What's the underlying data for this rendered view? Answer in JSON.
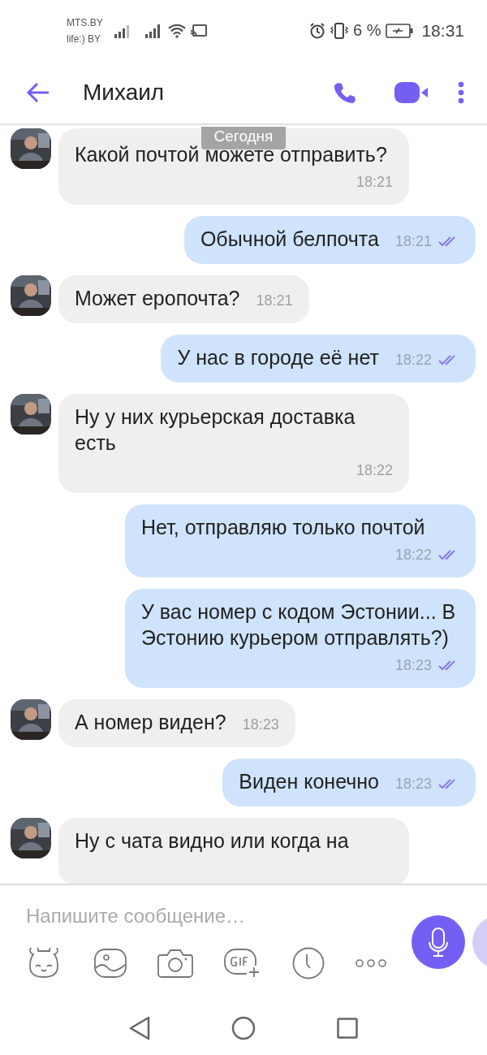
{
  "status_bar": {
    "carriers": [
      "MTS.BY",
      "life:) BY"
    ],
    "battery": "6 %",
    "time": "18:31"
  },
  "header": {
    "title": "Михаил"
  },
  "date_badge": "Сегодня",
  "messages": [
    {
      "kind": "received",
      "text": "Какой почтой можете отправить?",
      "time": "18:21"
    },
    {
      "kind": "sent",
      "text": "Обычной белпочта",
      "time": "18:21"
    },
    {
      "kind": "received",
      "text": "Может еропочта?",
      "time": "18:21"
    },
    {
      "kind": "sent",
      "text": "У нас в городе её нет",
      "time": "18:22"
    },
    {
      "kind": "received",
      "text": "Ну у них курьерская доставка есть",
      "time": "18:22"
    },
    {
      "kind": "sent",
      "text": "Нет, отправляю только почтой",
      "time": "18:22"
    },
    {
      "kind": "sent",
      "text": "У вас номер с кодом Эстонии... В Эстонию курьером отправлять?)",
      "time": "18:23"
    },
    {
      "kind": "received",
      "text": "А номер виден?",
      "time": "18:23"
    },
    {
      "kind": "sent",
      "text": "Виден конечно",
      "time": "18:23"
    },
    {
      "kind": "received",
      "text": "Ну с чата видно или когда на"
    }
  ],
  "composer": {
    "placeholder": "Напишите сообщение…"
  }
}
